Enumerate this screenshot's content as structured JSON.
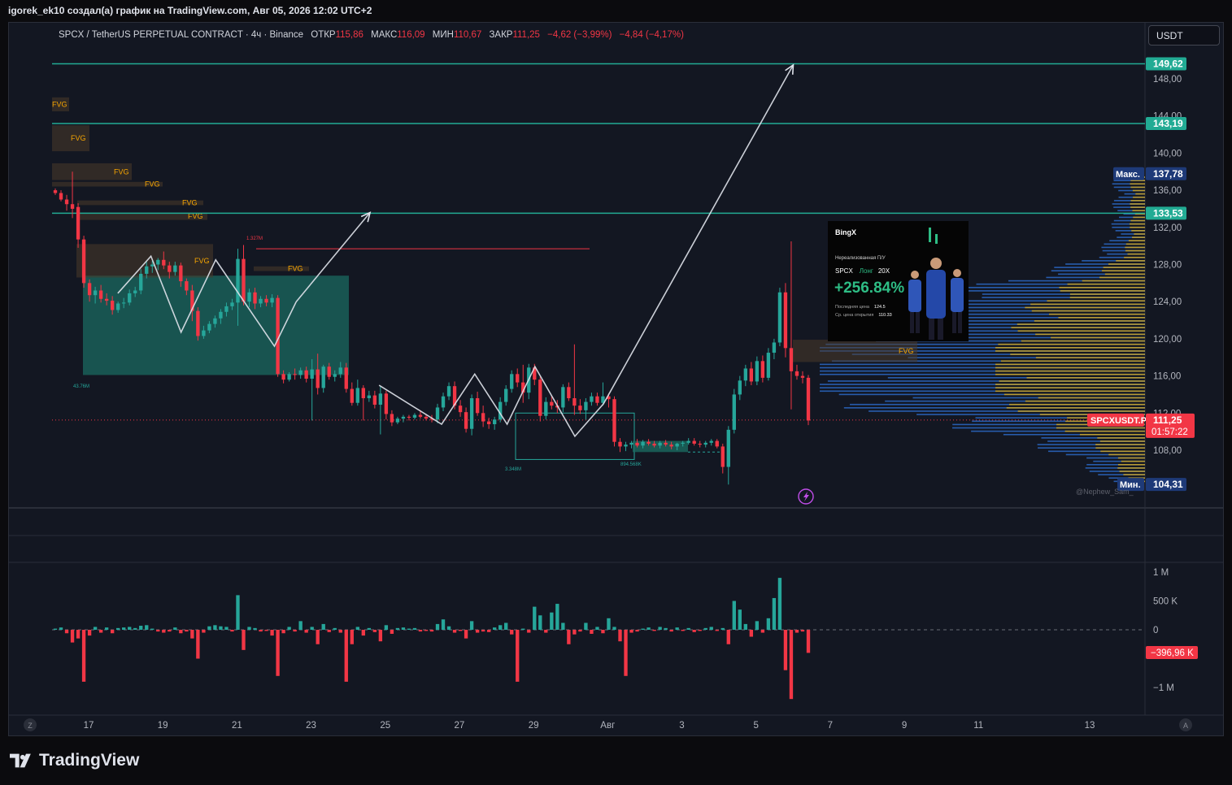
{
  "caption": "igorek_ek10 создал(а) график на TradingView.com, Авг 05, 2026 12:02 UTC+2",
  "header": {
    "symbol": "SPCX / TetherUS PERPETUAL CONTRACT · 4ч · Binance",
    "open_label": "ОТКР",
    "open": "115,86",
    "high_label": "МАКС",
    "high": "116,09",
    "low_label": "МИН",
    "low": "110,67",
    "close_label": "ЗАКР",
    "close": "111,25",
    "change": "−4,62 (−3,99%)",
    "change2": "−4,84 (−4,17%)"
  },
  "currency": "USDT",
  "brand": "TradingView",
  "watermark": "@Nephew_Sam_",
  "colors": {
    "up": "#26a69a",
    "down": "#f23645",
    "level": "#22ab94",
    "bg": "#131722",
    "fvg": "#f7a600"
  },
  "chart_data": [
    {
      "type": "candlestick",
      "xlabels": [
        "17",
        "19",
        "21",
        "23",
        "25",
        "27",
        "29",
        "Авг",
        "3",
        "5",
        "7",
        "9",
        "11",
        "13"
      ],
      "y_ticks": [
        "148,00",
        "144,00",
        "140,00",
        "136,00",
        "132,00",
        "128,00",
        "124,00",
        "120,00",
        "116,00",
        "112,00",
        "108,00"
      ],
      "ylim": [
        102.4,
        151.8
      ],
      "levels": [
        {
          "value": 149.62,
          "label": "149,62"
        },
        {
          "value": 143.19,
          "label": "143,19"
        },
        {
          "value": 133.53,
          "label": "133,53"
        }
      ],
      "max_label": "Макс.",
      "max_value": "137,78",
      "min_label": "Мин.",
      "min_value": "104,31",
      "last_symbol": "SPCXUSDT.P",
      "last_price": "111,25",
      "countdown": "01:57:22",
      "last_price_value": 111.25,
      "fvg_label": "FVG",
      "fvg_zones": [
        {
          "y1": 146.0,
          "y2": 144.5
        },
        {
          "y1": 143.0,
          "y2": 140.2
        },
        {
          "y1": 138.9,
          "y2": 137.1
        },
        {
          "y1": 136.9,
          "y2": 136.4
        },
        {
          "y1": 134.9,
          "y2": 134.4
        },
        {
          "y1": 133.6,
          "y2": 132.8
        },
        {
          "y1": 130.2,
          "y2": 126.6
        },
        {
          "y1": 127.8,
          "y2": 127.3
        },
        {
          "y1": 119.9,
          "y2": 117.5
        }
      ],
      "volume_labels": [
        "1.327M",
        "43.76M",
        "3.348M",
        "894.568K"
      ],
      "candles": [
        [
          136.0,
          136.2,
          135.5,
          135.7
        ],
        [
          135.7,
          136.0,
          134.8,
          135.0
        ],
        [
          135.0,
          135.5,
          133.8,
          134.5
        ],
        [
          134.5,
          138.0,
          133.0,
          134.0
        ],
        [
          134.2,
          134.6,
          129.8,
          130.7
        ],
        [
          130.7,
          131.1,
          125.5,
          126.0
        ],
        [
          126.0,
          126.4,
          124.0,
          124.7
        ],
        [
          124.7,
          125.6,
          123.8,
          125.2
        ],
        [
          125.2,
          125.8,
          123.9,
          124.3
        ],
        [
          124.3,
          124.9,
          123.6,
          124.1
        ],
        [
          124.1,
          124.6,
          122.6,
          123.1
        ],
        [
          123.1,
          124.0,
          122.8,
          123.8
        ],
        [
          123.8,
          124.4,
          123.3,
          123.9
        ],
        [
          123.9,
          125.3,
          123.6,
          124.9
        ],
        [
          124.9,
          125.6,
          124.5,
          125.2
        ],
        [
          125.2,
          127.5,
          124.8,
          127.0
        ],
        [
          127.0,
          128.3,
          126.5,
          127.8
        ],
        [
          127.8,
          128.4,
          127.1,
          128.0
        ],
        [
          128.0,
          128.7,
          127.4,
          128.5
        ],
        [
          128.5,
          129.4,
          127.5,
          127.9
        ],
        [
          127.9,
          128.3,
          126.5,
          127.2
        ],
        [
          127.2,
          128.3,
          126.8,
          127.9
        ],
        [
          127.9,
          128.2,
          125.6,
          126.2
        ],
        [
          126.2,
          126.5,
          124.7,
          125.2
        ],
        [
          125.2,
          125.8,
          121.9,
          123.0
        ],
        [
          123.0,
          123.4,
          119.8,
          120.3
        ],
        [
          120.3,
          121.4,
          120.0,
          120.9
        ],
        [
          120.9,
          121.9,
          120.6,
          121.6
        ],
        [
          121.6,
          122.5,
          121.2,
          122.2
        ],
        [
          122.2,
          123.2,
          121.6,
          122.9
        ],
        [
          122.9,
          123.9,
          122.4,
          123.5
        ],
        [
          123.5,
          124.3,
          123.1,
          123.9
        ],
        [
          123.9,
          129.7,
          121.4,
          128.6
        ],
        [
          128.6,
          130.1,
          123.6,
          124.0
        ],
        [
          124.0,
          125.4,
          123.4,
          125.0
        ],
        [
          125.0,
          125.5,
          123.2,
          123.8
        ],
        [
          123.8,
          124.6,
          123.4,
          124.3
        ],
        [
          124.3,
          124.7,
          123.5,
          123.9
        ],
        [
          123.9,
          124.8,
          123.4,
          124.4
        ],
        [
          124.4,
          124.7,
          115.9,
          116.2
        ],
        [
          116.2,
          116.6,
          115.2,
          115.6
        ],
        [
          115.6,
          116.4,
          115.4,
          116.2
        ],
        [
          116.2,
          116.8,
          115.6,
          116.1
        ],
        [
          116.1,
          116.9,
          115.7,
          116.6
        ],
        [
          116.6,
          117.0,
          115.3,
          115.7
        ],
        [
          115.7,
          117.8,
          111.2,
          116.7
        ],
        [
          116.7,
          118.4,
          114.0,
          114.7
        ],
        [
          114.7,
          117.2,
          114.2,
          117.0
        ],
        [
          117.0,
          117.4,
          115.6,
          115.9
        ],
        [
          115.9,
          116.6,
          115.4,
          116.2
        ],
        [
          116.2,
          117.5,
          115.8,
          116.9
        ],
        [
          116.9,
          117.4,
          114.2,
          114.6
        ],
        [
          114.6,
          115.3,
          112.8,
          113.1
        ],
        [
          113.1,
          115.6,
          112.8,
          114.7
        ],
        [
          114.7,
          115.0,
          111.2,
          113.6
        ],
        [
          113.6,
          114.4,
          113.2,
          113.9
        ],
        [
          113.9,
          114.4,
          112.5,
          112.9
        ],
        [
          112.9,
          114.9,
          109.7,
          114.1
        ],
        [
          114.1,
          114.4,
          111.3,
          111.9
        ],
        [
          111.9,
          112.3,
          110.6,
          111.0
        ],
        [
          111.0,
          111.6,
          110.8,
          111.4
        ],
        [
          111.4,
          111.8,
          111.0,
          111.6
        ],
        [
          111.6,
          111.8,
          111.2,
          111.5
        ],
        [
          111.5,
          112.0,
          111.3,
          111.8
        ],
        [
          111.8,
          112.3,
          111.4,
          111.6
        ],
        [
          111.6,
          111.9,
          111.2,
          111.4
        ],
        [
          111.4,
          111.8,
          111.0,
          111.3
        ],
        [
          111.3,
          113.0,
          110.9,
          112.6
        ],
        [
          112.6,
          114.2,
          112.2,
          113.8
        ],
        [
          113.8,
          115.3,
          113.4,
          114.9
        ],
        [
          114.9,
          115.4,
          112.4,
          112.8
        ],
        [
          112.8,
          113.4,
          111.6,
          112.1
        ],
        [
          112.1,
          112.6,
          109.9,
          110.3
        ],
        [
          110.3,
          114.0,
          109.6,
          113.6
        ],
        [
          113.6,
          114.3,
          111.7,
          112.0
        ],
        [
          112.0,
          112.8,
          110.5,
          111.1
        ],
        [
          111.1,
          111.5,
          110.3,
          110.8
        ],
        [
          110.8,
          111.6,
          110.2,
          111.3
        ],
        [
          111.3,
          113.7,
          111.0,
          113.2
        ],
        [
          113.2,
          115.0,
          112.8,
          114.6
        ],
        [
          114.6,
          116.6,
          114.2,
          116.2
        ],
        [
          116.2,
          116.8,
          114.8,
          115.3
        ],
        [
          115.3,
          117.2,
          113.1,
          114.2
        ],
        [
          114.2,
          117.3,
          113.5,
          116.9
        ],
        [
          116.9,
          117.3,
          115.0,
          115.6
        ],
        [
          115.6,
          115.9,
          111.1,
          111.7
        ],
        [
          111.7,
          113.7,
          111.3,
          113.2
        ],
        [
          113.2,
          113.8,
          112.4,
          112.8
        ],
        [
          112.8,
          113.4,
          112.0,
          112.6
        ],
        [
          112.6,
          115.1,
          112.1,
          114.8
        ],
        [
          114.8,
          115.3,
          113.3,
          113.6
        ],
        [
          113.6,
          119.4,
          111.8,
          112.8
        ],
        [
          112.8,
          113.5,
          111.9,
          112.3
        ],
        [
          112.3,
          113.6,
          111.3,
          113.2
        ],
        [
          113.2,
          114.2,
          112.8,
          113.8
        ],
        [
          113.8,
          114.2,
          112.8,
          113.1
        ],
        [
          113.1,
          115.3,
          112.8,
          113.8
        ],
        [
          113.8,
          114.1,
          112.6,
          113.5
        ],
        [
          113.5,
          113.8,
          108.4,
          108.9
        ],
        [
          108.9,
          109.3,
          107.8,
          108.4
        ],
        [
          108.4,
          108.9,
          107.9,
          108.6
        ],
        [
          108.6,
          109.0,
          108.2,
          108.8
        ],
        [
          108.8,
          109.2,
          108.3,
          108.5
        ],
        [
          108.5,
          109.1,
          108.2,
          108.9
        ],
        [
          108.9,
          109.2,
          108.5,
          108.7
        ],
        [
          108.7,
          109.0,
          108.3,
          108.5
        ],
        [
          108.5,
          109.0,
          108.2,
          108.8
        ],
        [
          108.8,
          109.1,
          108.4,
          108.6
        ],
        [
          108.6,
          108.9,
          108.1,
          108.4
        ],
        [
          108.4,
          108.8,
          108.0,
          108.7
        ],
        [
          108.7,
          109.0,
          108.4,
          108.8
        ],
        [
          108.8,
          109.3,
          108.6,
          109.0
        ],
        [
          109.0,
          109.3,
          108.5,
          108.7
        ],
        [
          108.7,
          109.0,
          108.3,
          108.6
        ],
        [
          108.6,
          109.0,
          108.3,
          108.8
        ],
        [
          108.8,
          109.2,
          108.5,
          109.0
        ],
        [
          109.0,
          109.2,
          108.2,
          108.4
        ],
        [
          108.4,
          108.7,
          105.5,
          106.2
        ],
        [
          106.2,
          110.6,
          104.3,
          110.2
        ],
        [
          110.2,
          114.6,
          109.8,
          114.0
        ],
        [
          114.0,
          116.0,
          113.4,
          115.5
        ],
        [
          115.5,
          117.2,
          114.9,
          116.8
        ],
        [
          116.8,
          117.5,
          115.0,
          115.4
        ],
        [
          115.4,
          118.1,
          115.0,
          117.6
        ],
        [
          117.6,
          118.2,
          115.3,
          115.8
        ],
        [
          115.8,
          119.0,
          115.5,
          118.5
        ],
        [
          118.5,
          120.0,
          117.8,
          119.6
        ],
        [
          119.6,
          125.5,
          119.2,
          125.0
        ],
        [
          125.0,
          126.0,
          118.0,
          119.0
        ],
        [
          119.0,
          130.5,
          112.4,
          116.5
        ],
        [
          116.5,
          117.2,
          115.6,
          116.0
        ],
        [
          116.0,
          116.5,
          115.2,
          115.8
        ],
        [
          115.8,
          116.1,
          110.7,
          111.2
        ]
      ],
      "volumes": [
        0.02,
        0.04,
        -0.06,
        -0.22,
        -0.15,
        -0.9,
        -0.1,
        0.05,
        -0.05,
        0.04,
        -0.06,
        0.03,
        0.04,
        0.05,
        0.03,
        0.07,
        0.08,
        0.02,
        -0.03,
        -0.05,
        -0.03,
        0.04,
        -0.06,
        -0.03,
        -0.15,
        -0.5,
        -0.05,
        0.06,
        0.08,
        0.06,
        0.05,
        -0.03,
        0.6,
        -0.35,
        0.05,
        0.03,
        -0.03,
        -0.02,
        -0.1,
        -0.8,
        -0.06,
        0.05,
        -0.03,
        0.15,
        -0.05,
        0.05,
        -0.25,
        0.1,
        -0.04,
        0.03,
        -0.05,
        -0.9,
        -0.25,
        0.05,
        -0.1,
        0.03,
        -0.04,
        -0.2,
        0.08,
        -0.07,
        0.03,
        0.04,
        0.02,
        0.03,
        -0.03,
        -0.02,
        -0.03,
        0.1,
        0.18,
        0.06,
        -0.05,
        -0.02,
        -0.15,
        0.15,
        -0.05,
        -0.03,
        -0.04,
        0.04,
        0.08,
        0.12,
        -0.08,
        -0.9,
        0.02,
        -0.05,
        0.4,
        0.25,
        -0.05,
        0.3,
        0.45,
        0.12,
        -0.25,
        -0.08,
        -0.03,
        0.12,
        -0.07,
        0.05,
        -0.06,
        0.2,
        0.05,
        -0.2,
        -0.8,
        -0.05,
        -0.03,
        0.02,
        0.04,
        -0.02,
        0.05,
        0.03,
        -0.03,
        0.04,
        -0.02,
        0.03,
        -0.04,
        -0.02,
        0.03,
        0.05,
        -0.02,
        0.03,
        -0.25,
        0.5,
        0.35,
        0.1,
        -0.12,
        0.15,
        -0.05,
        0.2,
        0.55,
        0.9,
        -0.7,
        -1.2,
        -0.05,
        -0.03,
        -0.4
      ],
      "volume_axis": [
        "1 M",
        "500 K",
        "0",
        "−1 M"
      ],
      "volume_last": "−396,96 K"
    }
  ],
  "popup": {
    "brand": "BingX",
    "label": "Нереализованная П/У",
    "symbol": "SPCX",
    "side": "Лонг",
    "leverage": "20X",
    "pnl": "+256.84%",
    "last_price_label": "Последняя цена",
    "last_price": "124.5",
    "avg_open_label": "Ср. цена открытия",
    "avg_open": "110.33"
  }
}
